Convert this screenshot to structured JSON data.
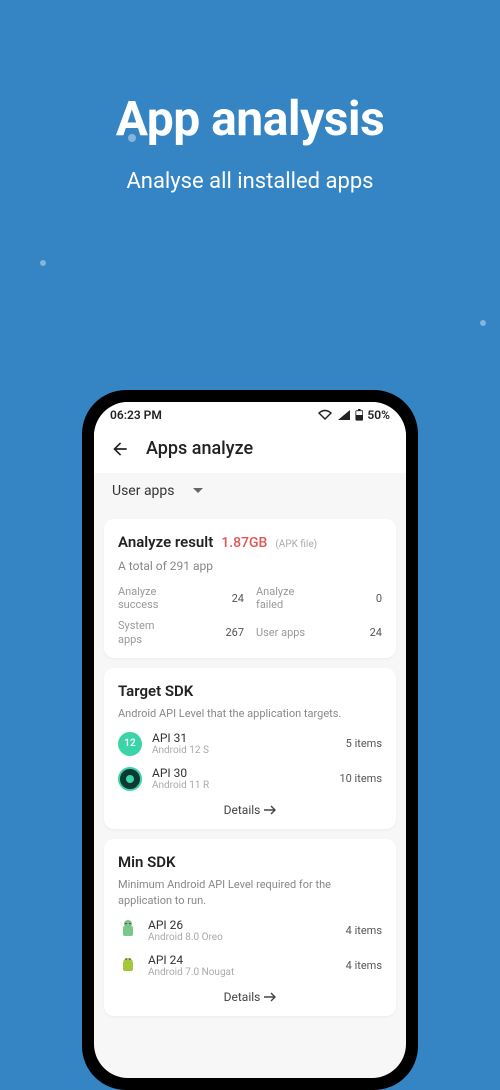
{
  "promo": {
    "title": "App analysis",
    "subtitle": "Analyse all installed apps"
  },
  "statusbar": {
    "time": "06:23 PM",
    "battery": "50%"
  },
  "header": {
    "title": "Apps analyze"
  },
  "filter": {
    "label": "User apps"
  },
  "analyze_result": {
    "title": "Analyze result",
    "size": "1.87GB",
    "apk_label": "(APK file)",
    "total": "A total of 291 app",
    "stats": [
      {
        "label": "Analyze success",
        "value": "24"
      },
      {
        "label": "Analyze failed",
        "value": "0"
      },
      {
        "label": "System apps",
        "value": "267"
      },
      {
        "label": "User apps",
        "value": "24"
      }
    ]
  },
  "target_sdk": {
    "title": "Target SDK",
    "desc": "Android API Level that the application targets.",
    "rows": [
      {
        "api": "API 31",
        "ver": "Android 12 S",
        "count": "5 items"
      },
      {
        "api": "API 30",
        "ver": "Android 11 R",
        "count": "10 items"
      }
    ],
    "details": "Details"
  },
  "min_sdk": {
    "title": "Min SDK",
    "desc": "Minimum Android API Level required for the application to run.",
    "rows": [
      {
        "api": "API 26",
        "ver": "Android 8.0 Oreo",
        "count": "4 items"
      },
      {
        "api": "API 24",
        "ver": "Android 7.0 Nougat",
        "count": "4 items"
      }
    ],
    "details": "Details"
  }
}
